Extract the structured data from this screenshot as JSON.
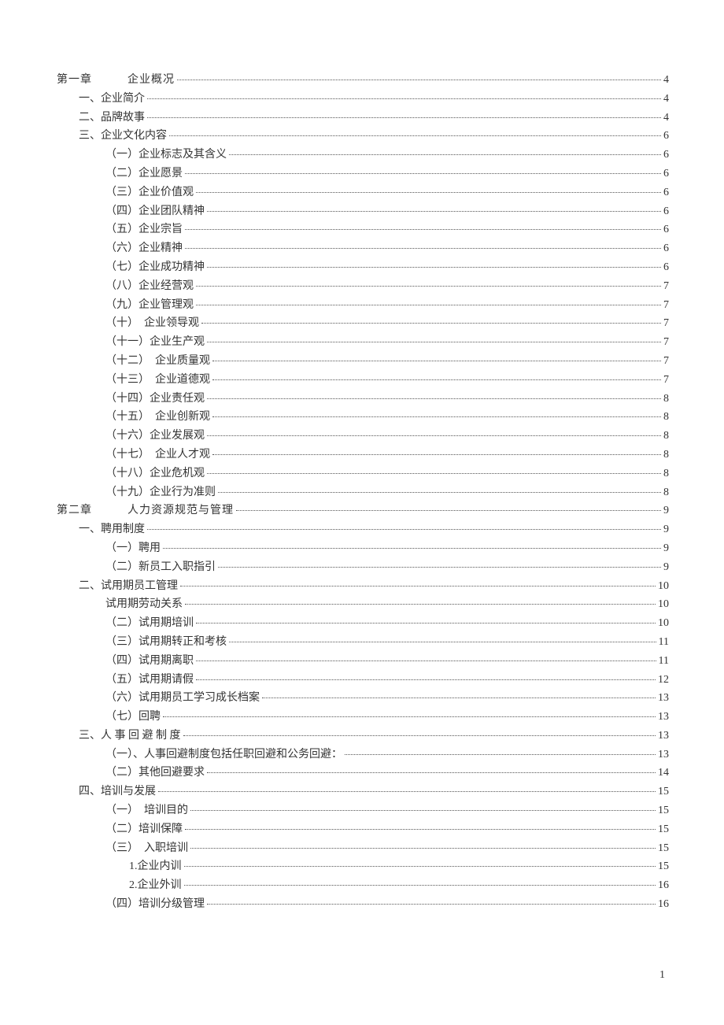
{
  "page_number": "1",
  "toc": [
    {
      "level": "chapter",
      "prefix": "第一章",
      "title": "企业概况",
      "page": "4"
    },
    {
      "level": "section",
      "prefix": "一、",
      "title": "企业简介",
      "page": "4"
    },
    {
      "level": "section",
      "prefix": "二、",
      "title": "品牌故事",
      "page": "4"
    },
    {
      "level": "section",
      "prefix": "三、",
      "title": "企业文化内容",
      "page": "6"
    },
    {
      "level": "subsection",
      "prefix": "（一）",
      "title": "企业标志及其含义",
      "page": "6"
    },
    {
      "level": "subsection",
      "prefix": "（二）",
      "title": "企业愿景",
      "page": "6"
    },
    {
      "level": "subsection",
      "prefix": "（三）",
      "title": "企业价值观",
      "page": "6"
    },
    {
      "level": "subsection",
      "prefix": "（四）",
      "title": "企业团队精神",
      "page": "6"
    },
    {
      "level": "subsection",
      "prefix": "（五）",
      "title": "企业宗旨",
      "page": "6"
    },
    {
      "level": "subsection",
      "prefix": "（六）",
      "title": "企业精神",
      "page": "6"
    },
    {
      "level": "subsection",
      "prefix": "（七）",
      "title": "企业成功精神",
      "page": "6"
    },
    {
      "level": "subsection",
      "prefix": "（八）",
      "title": "企业经营观",
      "page": "7"
    },
    {
      "level": "subsection",
      "prefix": "（九）",
      "title": "企业管理观",
      "page": "7"
    },
    {
      "level": "subsection",
      "prefix": "（十）　",
      "title": "企业领导观",
      "page": "7"
    },
    {
      "level": "subsection",
      "prefix": "（十一）",
      "title": "企业生产观",
      "page": "7"
    },
    {
      "level": "subsection",
      "prefix": "（十二）　",
      "title": "企业质量观",
      "page": "7"
    },
    {
      "level": "subsection",
      "prefix": "（十三）　",
      "title": "企业道德观",
      "page": "7"
    },
    {
      "level": "subsection",
      "prefix": "（十四）",
      "title": "企业责任观",
      "page": "8"
    },
    {
      "level": "subsection",
      "prefix": "（十五）　",
      "title": "企业创新观",
      "page": "8"
    },
    {
      "level": "subsection",
      "prefix": "（十六）",
      "title": "企业发展观",
      "page": "8"
    },
    {
      "level": "subsection",
      "prefix": "（十七）　",
      "title": "企业人才观",
      "page": "8"
    },
    {
      "level": "subsection",
      "prefix": "（十八）",
      "title": "企业危机观",
      "page": "8"
    },
    {
      "level": "subsection",
      "prefix": "（十九）",
      "title": "企业行为准则",
      "page": "8"
    },
    {
      "level": "chapter",
      "prefix": "第二章",
      "title": "人力资源规范与管理",
      "page": "9"
    },
    {
      "level": "section",
      "prefix": "一、",
      "title": "聘用制度",
      "page": "9"
    },
    {
      "level": "subsection",
      "prefix": "（一）",
      "title": "聘用",
      "page": "9"
    },
    {
      "level": "subsection",
      "prefix": "（二）",
      "title": "新员工入职指引",
      "page": "9"
    },
    {
      "level": "section",
      "prefix": "二、",
      "title": "试用期员工管理",
      "page": "10"
    },
    {
      "level": "subsection",
      "prefix": "",
      "title": "试用期劳动关系",
      "page": "10"
    },
    {
      "level": "subsection",
      "prefix": "（二）",
      "title": "试用期培训",
      "page": "10"
    },
    {
      "level": "subsection",
      "prefix": "（三）",
      "title": "试用期转正和考核",
      "page": "11"
    },
    {
      "level": "subsection",
      "prefix": "（四）",
      "title": "试用期离职",
      "page": "11"
    },
    {
      "level": "subsection",
      "prefix": "（五）",
      "title": "试用期请假",
      "page": "12"
    },
    {
      "level": "subsection",
      "prefix": "（六）",
      "title": "试用期员工学习成长档案",
      "page": "13"
    },
    {
      "level": "subsection",
      "prefix": "（七）",
      "title": "回聘",
      "page": "13"
    },
    {
      "level": "section",
      "prefix": "三、",
      "title": "人 事 回 避 制 度",
      "page": "13"
    },
    {
      "level": "subsection",
      "prefix": "（一）、",
      "title": "人事回避制度包括任职回避和公务回避：",
      "page": "13"
    },
    {
      "level": "subsection",
      "prefix": "（二）",
      "title": "其他回避要求",
      "page": "14"
    },
    {
      "level": "section",
      "prefix": "四、",
      "title": "培训与发展",
      "page": "15"
    },
    {
      "level": "subsection",
      "prefix": "（一）　",
      "title": "培训目的",
      "page": "15"
    },
    {
      "level": "subsection",
      "prefix": "（二）",
      "title": "培训保障",
      "page": "15"
    },
    {
      "level": "subsection",
      "prefix": "（三）　",
      "title": "入职培训",
      "page": "15"
    },
    {
      "level": "subsubsection",
      "prefix": "1.",
      "title": "企业内训",
      "page": "15"
    },
    {
      "level": "subsubsection",
      "prefix": "2.",
      "title": "企业外训",
      "page": "16"
    },
    {
      "level": "subsection",
      "prefix": "（四）",
      "title": "培训分级管理",
      "page": "16"
    }
  ]
}
